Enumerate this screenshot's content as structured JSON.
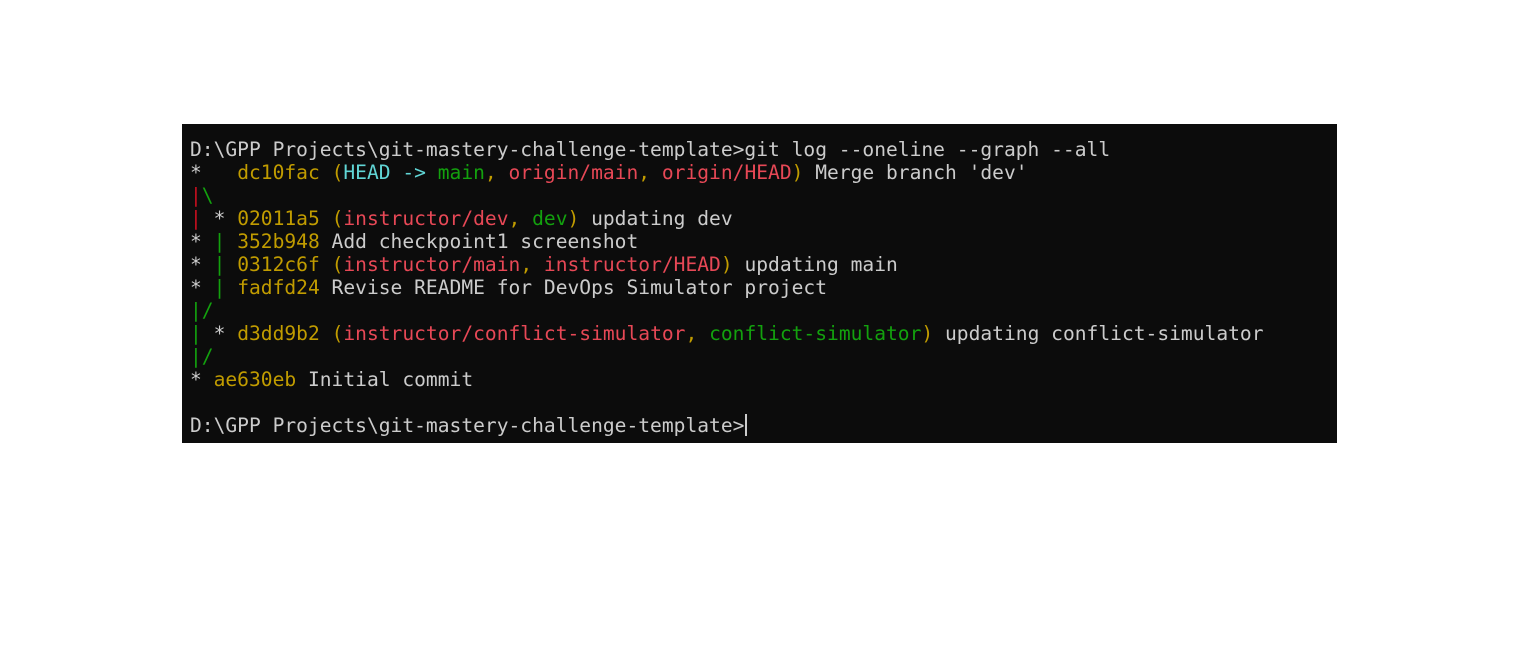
{
  "window": {
    "type": "terminal",
    "background": "#0c0c0c"
  },
  "palette": {
    "default": "#cccccc",
    "hash": "#c19c00",
    "head": "#61d6d6",
    "local_branch": "#13a10e",
    "remote_branch": "#e74856",
    "graph_red": "#c50f1f",
    "graph_green": "#13a10e"
  },
  "lines": [
    [
      {
        "t": "D:\\GPP Projects\\git-mastery-challenge-template>git log --oneline --graph --all",
        "c": "default"
      }
    ],
    [
      {
        "t": "*   ",
        "c": "default"
      },
      {
        "t": "dc10fac ",
        "c": "hash"
      },
      {
        "t": "(",
        "c": "hash"
      },
      {
        "t": "HEAD -> ",
        "c": "head"
      },
      {
        "t": "main",
        "c": "local_branch"
      },
      {
        "t": ", ",
        "c": "hash"
      },
      {
        "t": "origin/main",
        "c": "remote_branch"
      },
      {
        "t": ", ",
        "c": "hash"
      },
      {
        "t": "origin/HEAD",
        "c": "remote_branch"
      },
      {
        "t": ")",
        "c": "hash"
      },
      {
        "t": " Merge branch 'dev'",
        "c": "default"
      }
    ],
    [
      {
        "t": "|",
        "c": "graph_red"
      },
      {
        "t": "\\",
        "c": "graph_green"
      }
    ],
    [
      {
        "t": "|",
        "c": "graph_red"
      },
      {
        "t": " * ",
        "c": "default"
      },
      {
        "t": "02011a5 ",
        "c": "hash"
      },
      {
        "t": "(",
        "c": "hash"
      },
      {
        "t": "instructor/dev",
        "c": "remote_branch"
      },
      {
        "t": ", ",
        "c": "hash"
      },
      {
        "t": "dev",
        "c": "local_branch"
      },
      {
        "t": ")",
        "c": "hash"
      },
      {
        "t": " updating dev",
        "c": "default"
      }
    ],
    [
      {
        "t": "* ",
        "c": "default"
      },
      {
        "t": "|",
        "c": "graph_green"
      },
      {
        "t": " ",
        "c": "default"
      },
      {
        "t": "352b948",
        "c": "hash"
      },
      {
        "t": " Add checkpoint1 screenshot",
        "c": "default"
      }
    ],
    [
      {
        "t": "* ",
        "c": "default"
      },
      {
        "t": "|",
        "c": "graph_green"
      },
      {
        "t": " ",
        "c": "default"
      },
      {
        "t": "0312c6f ",
        "c": "hash"
      },
      {
        "t": "(",
        "c": "hash"
      },
      {
        "t": "instructor/main",
        "c": "remote_branch"
      },
      {
        "t": ", ",
        "c": "hash"
      },
      {
        "t": "instructor/HEAD",
        "c": "remote_branch"
      },
      {
        "t": ")",
        "c": "hash"
      },
      {
        "t": " updating main",
        "c": "default"
      }
    ],
    [
      {
        "t": "* ",
        "c": "default"
      },
      {
        "t": "|",
        "c": "graph_green"
      },
      {
        "t": " ",
        "c": "default"
      },
      {
        "t": "fadfd24",
        "c": "hash"
      },
      {
        "t": " Revise README for DevOps Simulator project",
        "c": "default"
      }
    ],
    [
      {
        "t": "|/",
        "c": "graph_green"
      }
    ],
    [
      {
        "t": "|",
        "c": "graph_green"
      },
      {
        "t": " * ",
        "c": "default"
      },
      {
        "t": "d3dd9b2 ",
        "c": "hash"
      },
      {
        "t": "(",
        "c": "hash"
      },
      {
        "t": "instructor/conflict-simulator",
        "c": "remote_branch"
      },
      {
        "t": ", ",
        "c": "hash"
      },
      {
        "t": "conflict-simulator",
        "c": "local_branch"
      },
      {
        "t": ")",
        "c": "hash"
      },
      {
        "t": " updating conflict-simulator",
        "c": "default"
      }
    ],
    [
      {
        "t": "|/",
        "c": "graph_green"
      }
    ],
    [
      {
        "t": "* ",
        "c": "default"
      },
      {
        "t": "ae630eb",
        "c": "hash"
      },
      {
        "t": " Initial commit",
        "c": "default"
      }
    ],
    [],
    [
      {
        "t": "D:\\GPP Projects\\git-mastery-challenge-template>",
        "c": "default"
      }
    ]
  ],
  "cursor_line": 12
}
